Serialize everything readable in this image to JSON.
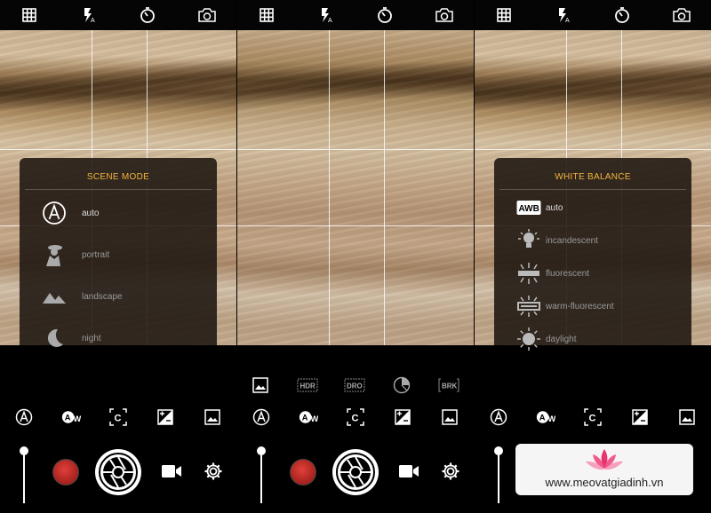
{
  "icons": {
    "top_bar": [
      "grid-icon",
      "flash-auto-icon",
      "timer-icon",
      "camera-switch-icon"
    ],
    "mode_bar": [
      "scene-mode-icon",
      "white-balance-icon",
      "color-effect-icon",
      "exposure-icon",
      "photo-mode-icon"
    ],
    "extra_bar": [
      "photo-mode-icon",
      "hdr-icon",
      "dro-icon",
      "focus-bracketing-icon",
      "brk-icon"
    ]
  },
  "scene_mode": {
    "title": "SCENE MODE",
    "items": [
      {
        "label": "auto",
        "icon": "auto-a-icon",
        "selected": true
      },
      {
        "label": "portrait",
        "icon": "portrait-icon",
        "selected": false
      },
      {
        "label": "landscape",
        "icon": "landscape-icon",
        "selected": false
      },
      {
        "label": "night",
        "icon": "night-moon-icon",
        "selected": false
      }
    ]
  },
  "white_balance": {
    "title": "WHITE BALANCE",
    "items": [
      {
        "label": "auto",
        "icon": "awb-icon",
        "selected": true
      },
      {
        "label": "incandescent",
        "icon": "bulb-icon",
        "selected": false
      },
      {
        "label": "fluorescent",
        "icon": "fluorescent-icon",
        "selected": false
      },
      {
        "label": "warm-fluorescent",
        "icon": "warm-fluorescent-icon",
        "selected": false
      },
      {
        "label": "daylight",
        "icon": "sun-icon",
        "selected": false
      }
    ]
  },
  "extra_labels": {
    "hdr": "HDR",
    "dro": "DRO",
    "brk": "BRK"
  },
  "mode_labels": {
    "awb_short": "A",
    "awb_w": "W",
    "awb": "AWB",
    "c": "C"
  },
  "watermark": {
    "text": "www.meovatgiadinh.vn"
  },
  "colors": {
    "accent": "#f2b43c",
    "record": "#c4261e",
    "overlay": "#1c1610"
  }
}
